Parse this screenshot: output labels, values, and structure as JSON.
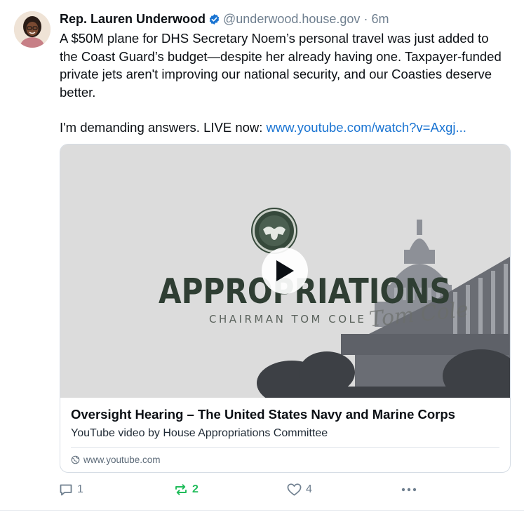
{
  "post": {
    "author": {
      "display_name": "Rep. Lauren Underwood",
      "handle": "@underwood.house.gov",
      "separator": "·",
      "time": "6m",
      "verified": true
    },
    "text": {
      "paragraph_1": "A $50M plane for DHS Secretary Noem’s personal travel was just added to the Coast Guard’s budget—despite her already having one. Taxpayer-funded private jets aren't improving our national security, and our Coasties deserve better.",
      "paragraph_2_prefix": "I'm demanding answers. LIVE now: ",
      "link_text": "www.youtube.com/watch?v=Axgj..."
    },
    "link_card": {
      "thumbnail": {
        "wordmark": "APPROPRIATIONS",
        "subtitle": "CHAIRMAN TOM COLE",
        "signature": "Tom Cole"
      },
      "title": "Oversight Hearing – The United States Navy and Marine Corps",
      "description": "YouTube video by House Appropriations Committee",
      "domain": "www.youtube.com"
    },
    "actions": {
      "reply_count": "1",
      "repost_count": "2",
      "like_count": "4"
    }
  },
  "colors": {
    "link": "#1a74d2",
    "verified": "#1a74d2",
    "repost_active": "#20bc5a",
    "muted": "#6f7f8f"
  },
  "icons": [
    "verified-badge-icon",
    "play-icon",
    "globe-icon",
    "reply-icon",
    "repost-icon",
    "like-icon",
    "more-icon"
  ]
}
